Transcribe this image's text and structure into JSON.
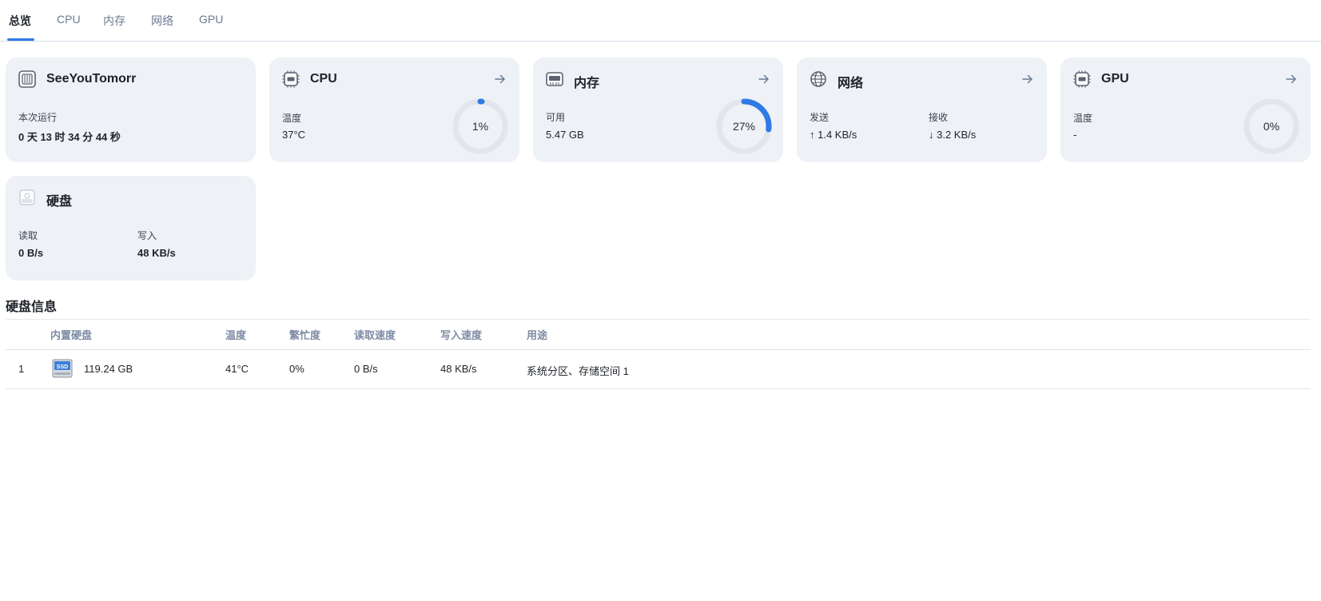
{
  "tabs": [
    "总览",
    "CPU",
    "内存",
    "网络",
    "GPU"
  ],
  "system": {
    "name": "SeeYouTomorr",
    "uptime_label": "本次运行",
    "uptime_value": "0 天 13 时 34 分 44 秒"
  },
  "cpu": {
    "title": "CPU",
    "temp_label": "温度",
    "temp_value": "37°C",
    "usage_text": "1%",
    "usage": 1
  },
  "memory": {
    "title": "内存",
    "avail_label": "可用",
    "avail_value": "5.47 GB",
    "usage_text": "27%",
    "usage": 27
  },
  "network": {
    "title": "网络",
    "send_label": "发送",
    "send_value": "↑ 1.4 KB/s",
    "recv_label": "接收",
    "recv_value": "↓ 3.2 KB/s"
  },
  "gpu": {
    "title": "GPU",
    "temp_label": "温度",
    "temp_value": "-",
    "usage_text": "0%",
    "usage": 0
  },
  "disk": {
    "title": "硬盘",
    "read_label": "读取",
    "read_value": "0 B/s",
    "write_label": "写入",
    "write_value": "48 KB/s"
  },
  "disk_info": {
    "title": "硬盘信息",
    "columns": [
      "内置硬盘",
      "温度",
      "繁忙度",
      "读取速度",
      "写入速度",
      "用途"
    ],
    "rows": [
      {
        "index": "1",
        "icon_label": "SSD",
        "capacity": "119.24 GB",
        "temp": "41°C",
        "busy": "0%",
        "read": "0 B/s",
        "write": "48 KB/s",
        "usage": "系统分区、存储空间 1"
      }
    ]
  },
  "colors": {
    "accent": "#2f7ae5",
    "card_bg": "#eef1f6",
    "track": "#e2e6ec",
    "muted": "#7d8ba3"
  }
}
